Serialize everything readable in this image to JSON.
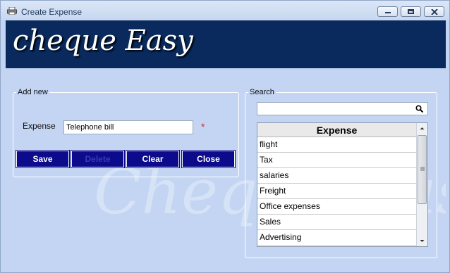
{
  "window": {
    "title": "Create Expense",
    "icons": {
      "app": "printer-icon",
      "minimize": "minimize-icon",
      "maximize": "maximize-icon",
      "close": "close-icon"
    }
  },
  "banner": {
    "title": "cheque Easy"
  },
  "watermark": "Cheque Eas",
  "add_new": {
    "legend": "Add new",
    "expense_label": "Expense",
    "expense_value": "Telephone bill",
    "required_mark": "*",
    "buttons": {
      "save": "Save",
      "delete": "Delete",
      "clear": "Clear",
      "close": "Close"
    }
  },
  "search": {
    "legend": "Search",
    "query": "",
    "icon": "search-icon",
    "grid_header": "Expense",
    "rows": [
      "flight",
      "Tax",
      "salaries",
      "Freight",
      "Office expenses",
      "Sales",
      "Advertising"
    ]
  },
  "colors": {
    "banner": "#0a2a5e",
    "button": "#0b0b8c",
    "background": "#c3d5f2",
    "required": "#e02020"
  }
}
